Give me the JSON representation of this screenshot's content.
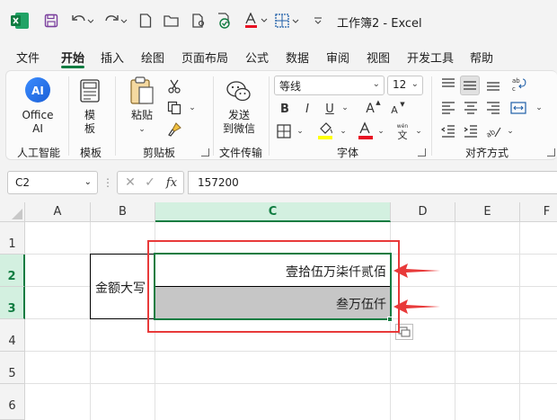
{
  "window": {
    "title": "工作簿2  -  Excel"
  },
  "menu": {
    "tabs": [
      "文件",
      "开始",
      "插入",
      "绘图",
      "页面布局",
      "公式",
      "数据",
      "审阅",
      "视图",
      "开发工具",
      "帮助"
    ],
    "active_index": 1
  },
  "ribbon": {
    "office_ai": {
      "line1": "Office",
      "line2": "AI"
    },
    "template": {
      "line1": "模",
      "line2": "板"
    },
    "paste": "粘贴",
    "send": {
      "line1": "发送",
      "line2": "到微信"
    },
    "font_name": "等线",
    "font_size": "12",
    "groups": {
      "ai": "人工智能",
      "template": "模板",
      "clipboard": "剪贴板",
      "transfer": "文件传输",
      "font": "字体",
      "align": "对齐方式"
    },
    "font_buttons": {
      "bold": "B",
      "italic": "I",
      "underline": "U",
      "grow": "A",
      "shrink": "A"
    },
    "colors": {
      "font_color": "#e81123",
      "fill_color": "#ffff00",
      "accent": "#107c41"
    }
  },
  "formula_bar": {
    "name_box": "C2",
    "fx_label": "fx",
    "value": "157200"
  },
  "grid": {
    "columns": [
      "A",
      "B",
      "C",
      "D",
      "E",
      "F"
    ],
    "selected_column": "C",
    "rows": [
      "1",
      "2",
      "3",
      "4",
      "5",
      "6"
    ],
    "selected_rows": [
      "2",
      "3"
    ],
    "cells": {
      "b2": "金额大写",
      "c2": "壹拾伍万柒仟贰佰",
      "c3": "叁万伍仟"
    }
  },
  "annotation": {
    "box_color": "#e83a3a",
    "arrow_color": "#e83a3a"
  }
}
